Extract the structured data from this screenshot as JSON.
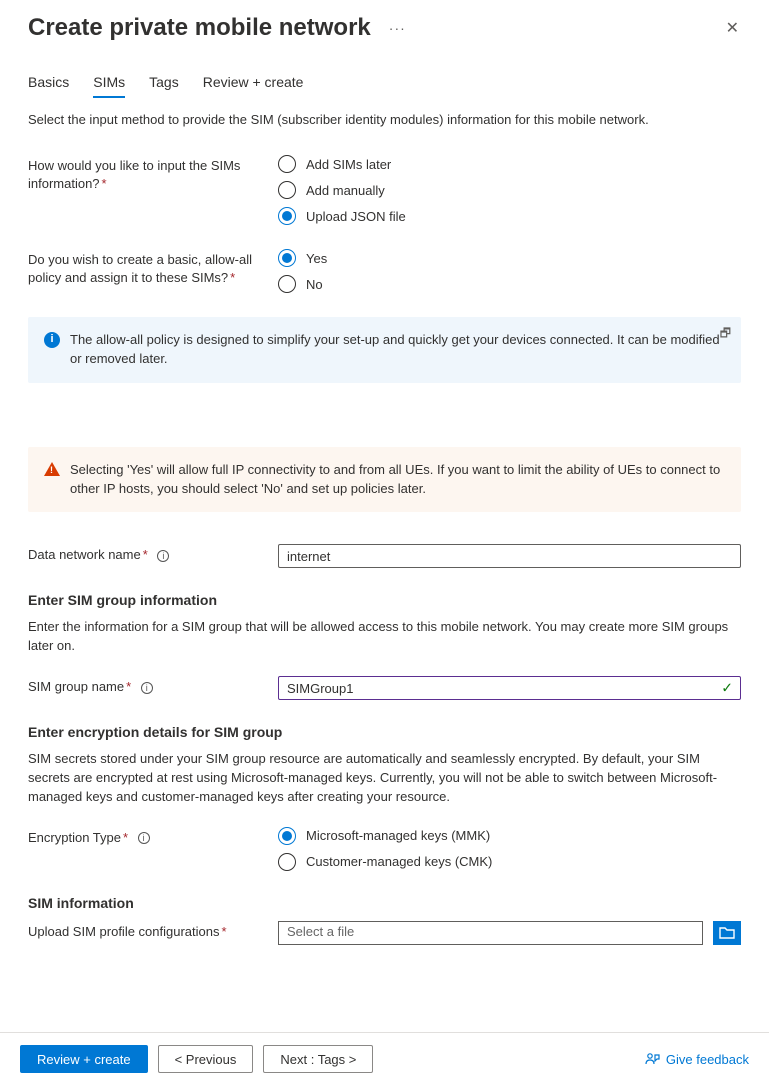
{
  "header": {
    "title": "Create private mobile network",
    "dots_icon": "more-icon",
    "close_icon": "close-icon"
  },
  "tabs": {
    "items": [
      {
        "label": "Basics",
        "active": false
      },
      {
        "label": "SIMs",
        "active": true
      },
      {
        "label": "Tags",
        "active": false
      },
      {
        "label": "Review + create",
        "active": false
      }
    ]
  },
  "intro": "Select the input method to provide the SIM (subscriber identity modules) information for this mobile network.",
  "input_method": {
    "label": "How would you like to input the SIMs information?",
    "options": [
      {
        "label": "Add SIMs later",
        "selected": false
      },
      {
        "label": "Add manually",
        "selected": false
      },
      {
        "label": "Upload JSON file",
        "selected": true
      }
    ]
  },
  "allow_all": {
    "label": "Do you wish to create a basic, allow-all policy and assign it to these SIMs?",
    "options": [
      {
        "label": "Yes",
        "selected": true
      },
      {
        "label": "No",
        "selected": false
      }
    ]
  },
  "info_banner": "The allow-all policy is designed to simplify your set-up and quickly get your devices connected. It can be modified or removed later.",
  "warn_banner": "Selecting 'Yes' will allow full IP connectivity to and from all UEs. If you want to limit the ability of UEs to connect to other IP hosts, you should select 'No' and set up policies later.",
  "data_network": {
    "label": "Data network name",
    "value": "internet"
  },
  "sim_group_section": {
    "heading": "Enter SIM group information",
    "desc": "Enter the information for a SIM group that will be allowed access to this mobile network. You may create more SIM groups later on.",
    "name_label": "SIM group name",
    "name_value": "SIMGroup1"
  },
  "encryption": {
    "heading": "Enter encryption details for SIM group",
    "desc": "SIM secrets stored under your SIM group resource are automatically and seamlessly encrypted. By default, your SIM secrets are encrypted at rest using Microsoft-managed keys. Currently, you will not be able to switch between Microsoft-managed keys and customer-managed keys after creating your resource.",
    "type_label": "Encryption Type",
    "options": [
      {
        "label": "Microsoft-managed keys (MMK)",
        "selected": true
      },
      {
        "label": "Customer-managed keys (CMK)",
        "selected": false
      }
    ]
  },
  "sim_info": {
    "heading": "SIM information",
    "upload_label": "Upload SIM profile configurations",
    "placeholder": "Select a file"
  },
  "footer": {
    "review": "Review + create",
    "previous": "<  Previous",
    "next": "Next : Tags  >",
    "feedback": "Give feedback"
  }
}
